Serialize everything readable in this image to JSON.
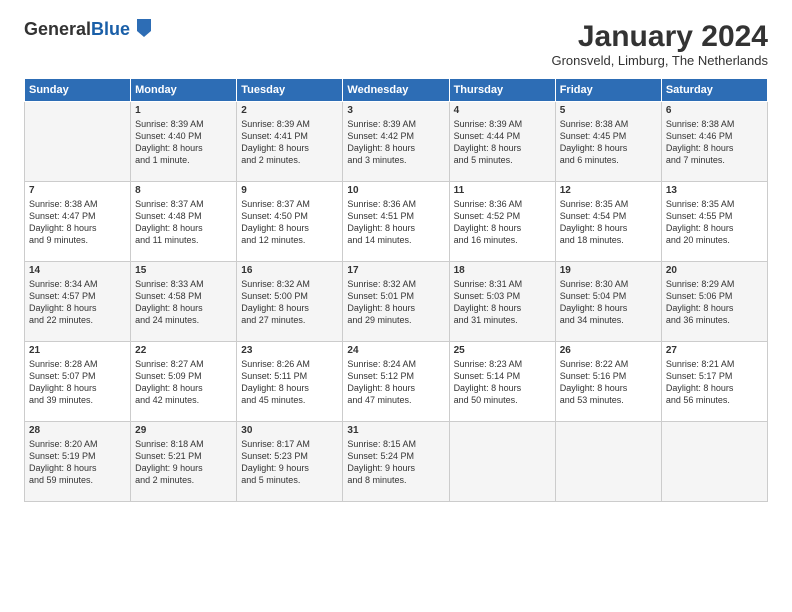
{
  "header": {
    "logo_general": "General",
    "logo_blue": "Blue",
    "month_title": "January 2024",
    "location": "Gronsveld, Limburg, The Netherlands"
  },
  "days_of_week": [
    "Sunday",
    "Monday",
    "Tuesday",
    "Wednesday",
    "Thursday",
    "Friday",
    "Saturday"
  ],
  "weeks": [
    [
      {
        "day": "",
        "info": ""
      },
      {
        "day": "1",
        "info": "Sunrise: 8:39 AM\nSunset: 4:40 PM\nDaylight: 8 hours\nand 1 minute."
      },
      {
        "day": "2",
        "info": "Sunrise: 8:39 AM\nSunset: 4:41 PM\nDaylight: 8 hours\nand 2 minutes."
      },
      {
        "day": "3",
        "info": "Sunrise: 8:39 AM\nSunset: 4:42 PM\nDaylight: 8 hours\nand 3 minutes."
      },
      {
        "day": "4",
        "info": "Sunrise: 8:39 AM\nSunset: 4:44 PM\nDaylight: 8 hours\nand 5 minutes."
      },
      {
        "day": "5",
        "info": "Sunrise: 8:38 AM\nSunset: 4:45 PM\nDaylight: 8 hours\nand 6 minutes."
      },
      {
        "day": "6",
        "info": "Sunrise: 8:38 AM\nSunset: 4:46 PM\nDaylight: 8 hours\nand 7 minutes."
      }
    ],
    [
      {
        "day": "7",
        "info": "Sunrise: 8:38 AM\nSunset: 4:47 PM\nDaylight: 8 hours\nand 9 minutes."
      },
      {
        "day": "8",
        "info": "Sunrise: 8:37 AM\nSunset: 4:48 PM\nDaylight: 8 hours\nand 11 minutes."
      },
      {
        "day": "9",
        "info": "Sunrise: 8:37 AM\nSunset: 4:50 PM\nDaylight: 8 hours\nand 12 minutes."
      },
      {
        "day": "10",
        "info": "Sunrise: 8:36 AM\nSunset: 4:51 PM\nDaylight: 8 hours\nand 14 minutes."
      },
      {
        "day": "11",
        "info": "Sunrise: 8:36 AM\nSunset: 4:52 PM\nDaylight: 8 hours\nand 16 minutes."
      },
      {
        "day": "12",
        "info": "Sunrise: 8:35 AM\nSunset: 4:54 PM\nDaylight: 8 hours\nand 18 minutes."
      },
      {
        "day": "13",
        "info": "Sunrise: 8:35 AM\nSunset: 4:55 PM\nDaylight: 8 hours\nand 20 minutes."
      }
    ],
    [
      {
        "day": "14",
        "info": "Sunrise: 8:34 AM\nSunset: 4:57 PM\nDaylight: 8 hours\nand 22 minutes."
      },
      {
        "day": "15",
        "info": "Sunrise: 8:33 AM\nSunset: 4:58 PM\nDaylight: 8 hours\nand 24 minutes."
      },
      {
        "day": "16",
        "info": "Sunrise: 8:32 AM\nSunset: 5:00 PM\nDaylight: 8 hours\nand 27 minutes."
      },
      {
        "day": "17",
        "info": "Sunrise: 8:32 AM\nSunset: 5:01 PM\nDaylight: 8 hours\nand 29 minutes."
      },
      {
        "day": "18",
        "info": "Sunrise: 8:31 AM\nSunset: 5:03 PM\nDaylight: 8 hours\nand 31 minutes."
      },
      {
        "day": "19",
        "info": "Sunrise: 8:30 AM\nSunset: 5:04 PM\nDaylight: 8 hours\nand 34 minutes."
      },
      {
        "day": "20",
        "info": "Sunrise: 8:29 AM\nSunset: 5:06 PM\nDaylight: 8 hours\nand 36 minutes."
      }
    ],
    [
      {
        "day": "21",
        "info": "Sunrise: 8:28 AM\nSunset: 5:07 PM\nDaylight: 8 hours\nand 39 minutes."
      },
      {
        "day": "22",
        "info": "Sunrise: 8:27 AM\nSunset: 5:09 PM\nDaylight: 8 hours\nand 42 minutes."
      },
      {
        "day": "23",
        "info": "Sunrise: 8:26 AM\nSunset: 5:11 PM\nDaylight: 8 hours\nand 45 minutes."
      },
      {
        "day": "24",
        "info": "Sunrise: 8:24 AM\nSunset: 5:12 PM\nDaylight: 8 hours\nand 47 minutes."
      },
      {
        "day": "25",
        "info": "Sunrise: 8:23 AM\nSunset: 5:14 PM\nDaylight: 8 hours\nand 50 minutes."
      },
      {
        "day": "26",
        "info": "Sunrise: 8:22 AM\nSunset: 5:16 PM\nDaylight: 8 hours\nand 53 minutes."
      },
      {
        "day": "27",
        "info": "Sunrise: 8:21 AM\nSunset: 5:17 PM\nDaylight: 8 hours\nand 56 minutes."
      }
    ],
    [
      {
        "day": "28",
        "info": "Sunrise: 8:20 AM\nSunset: 5:19 PM\nDaylight: 8 hours\nand 59 minutes."
      },
      {
        "day": "29",
        "info": "Sunrise: 8:18 AM\nSunset: 5:21 PM\nDaylight: 9 hours\nand 2 minutes."
      },
      {
        "day": "30",
        "info": "Sunrise: 8:17 AM\nSunset: 5:23 PM\nDaylight: 9 hours\nand 5 minutes."
      },
      {
        "day": "31",
        "info": "Sunrise: 8:15 AM\nSunset: 5:24 PM\nDaylight: 9 hours\nand 8 minutes."
      },
      {
        "day": "",
        "info": ""
      },
      {
        "day": "",
        "info": ""
      },
      {
        "day": "",
        "info": ""
      }
    ]
  ]
}
